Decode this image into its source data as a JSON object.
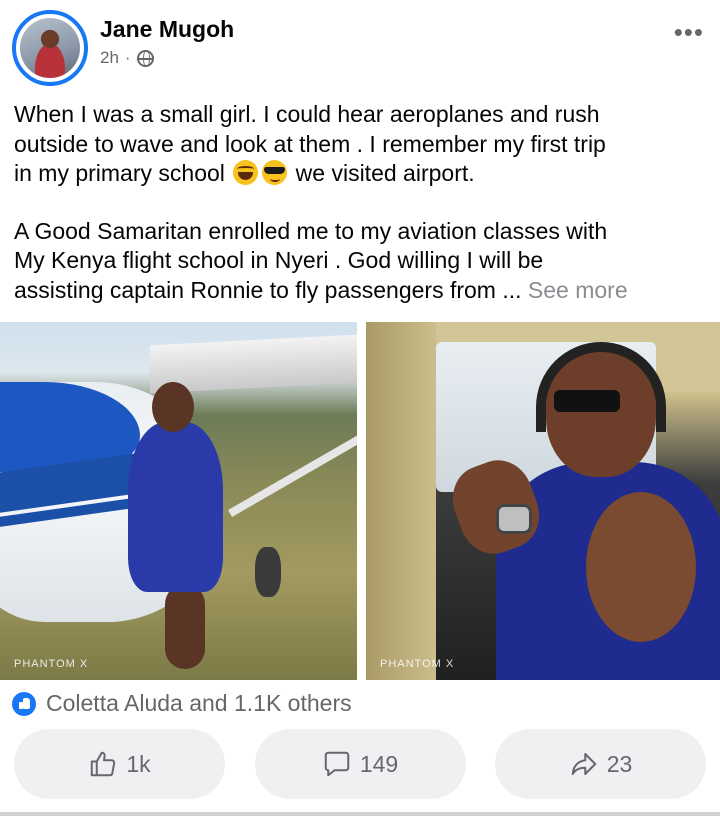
{
  "post": {
    "author": "Jane Mugoh",
    "time": "2h",
    "separator": "·",
    "privacy_icon": "globe-icon",
    "more_label": "•••",
    "text_lines_1": [
      "When I was a small girl. I could  hear aeroplanes  and rush",
      "outside to wave and look at  them .  I remember my first trip",
      "in  my primary school",
      "we visited airport."
    ],
    "text_lines_2": [
      "A  Good Samaritan   enrolled me to my  aviation classes  with",
      "My Kenya flight school in Nyeri  . God willing  I will   be",
      "assisting captain Ronnie to  fly passengers from ..."
    ],
    "see_more": "See more",
    "photos": [
      {
        "watermark": "PHANTOM X"
      },
      {
        "watermark": "PHANTOM X"
      }
    ]
  },
  "reactions": {
    "icon": "like-icon",
    "text": "Coletta Aluda and 1.1K others"
  },
  "actions": {
    "like_count": "1k",
    "comment_count": "149",
    "share_count": "23"
  },
  "colors": {
    "accent": "#1877f2",
    "muted": "#65676b",
    "button_bg": "#eff0f2"
  }
}
